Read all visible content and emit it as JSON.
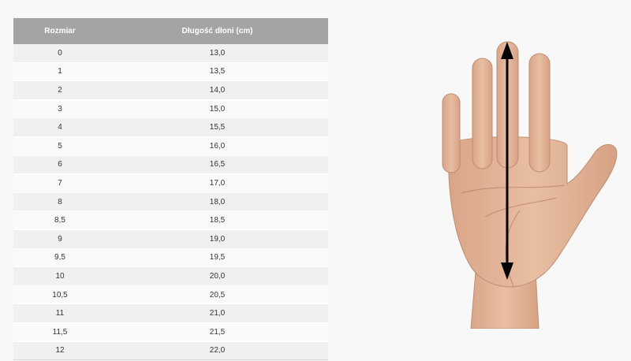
{
  "table": {
    "headers": [
      "Rozmiar",
      "Długość dłoni (cm)"
    ],
    "rows": [
      [
        "0",
        "13,0"
      ],
      [
        "1",
        "13,5"
      ],
      [
        "2",
        "14,0"
      ],
      [
        "3",
        "15,0"
      ],
      [
        "4",
        "15,5"
      ],
      [
        "5",
        "16,0"
      ],
      [
        "6",
        "16,5"
      ],
      [
        "7",
        "17,0"
      ],
      [
        "8",
        "18,0"
      ],
      [
        "8,5",
        "18,5"
      ],
      [
        "9",
        "19,0"
      ],
      [
        "9,5",
        "19,5"
      ],
      [
        "10",
        "20,0"
      ],
      [
        "10,5",
        "20,5"
      ],
      [
        "11",
        "21,0"
      ],
      [
        "11,5",
        "21,5"
      ],
      [
        "12",
        "22,0"
      ]
    ]
  },
  "illustration": {
    "subject": "hand-palm",
    "measurement_arrow": "double-headed",
    "skin_color": "#e3b497",
    "arrow_color": "#000000"
  }
}
